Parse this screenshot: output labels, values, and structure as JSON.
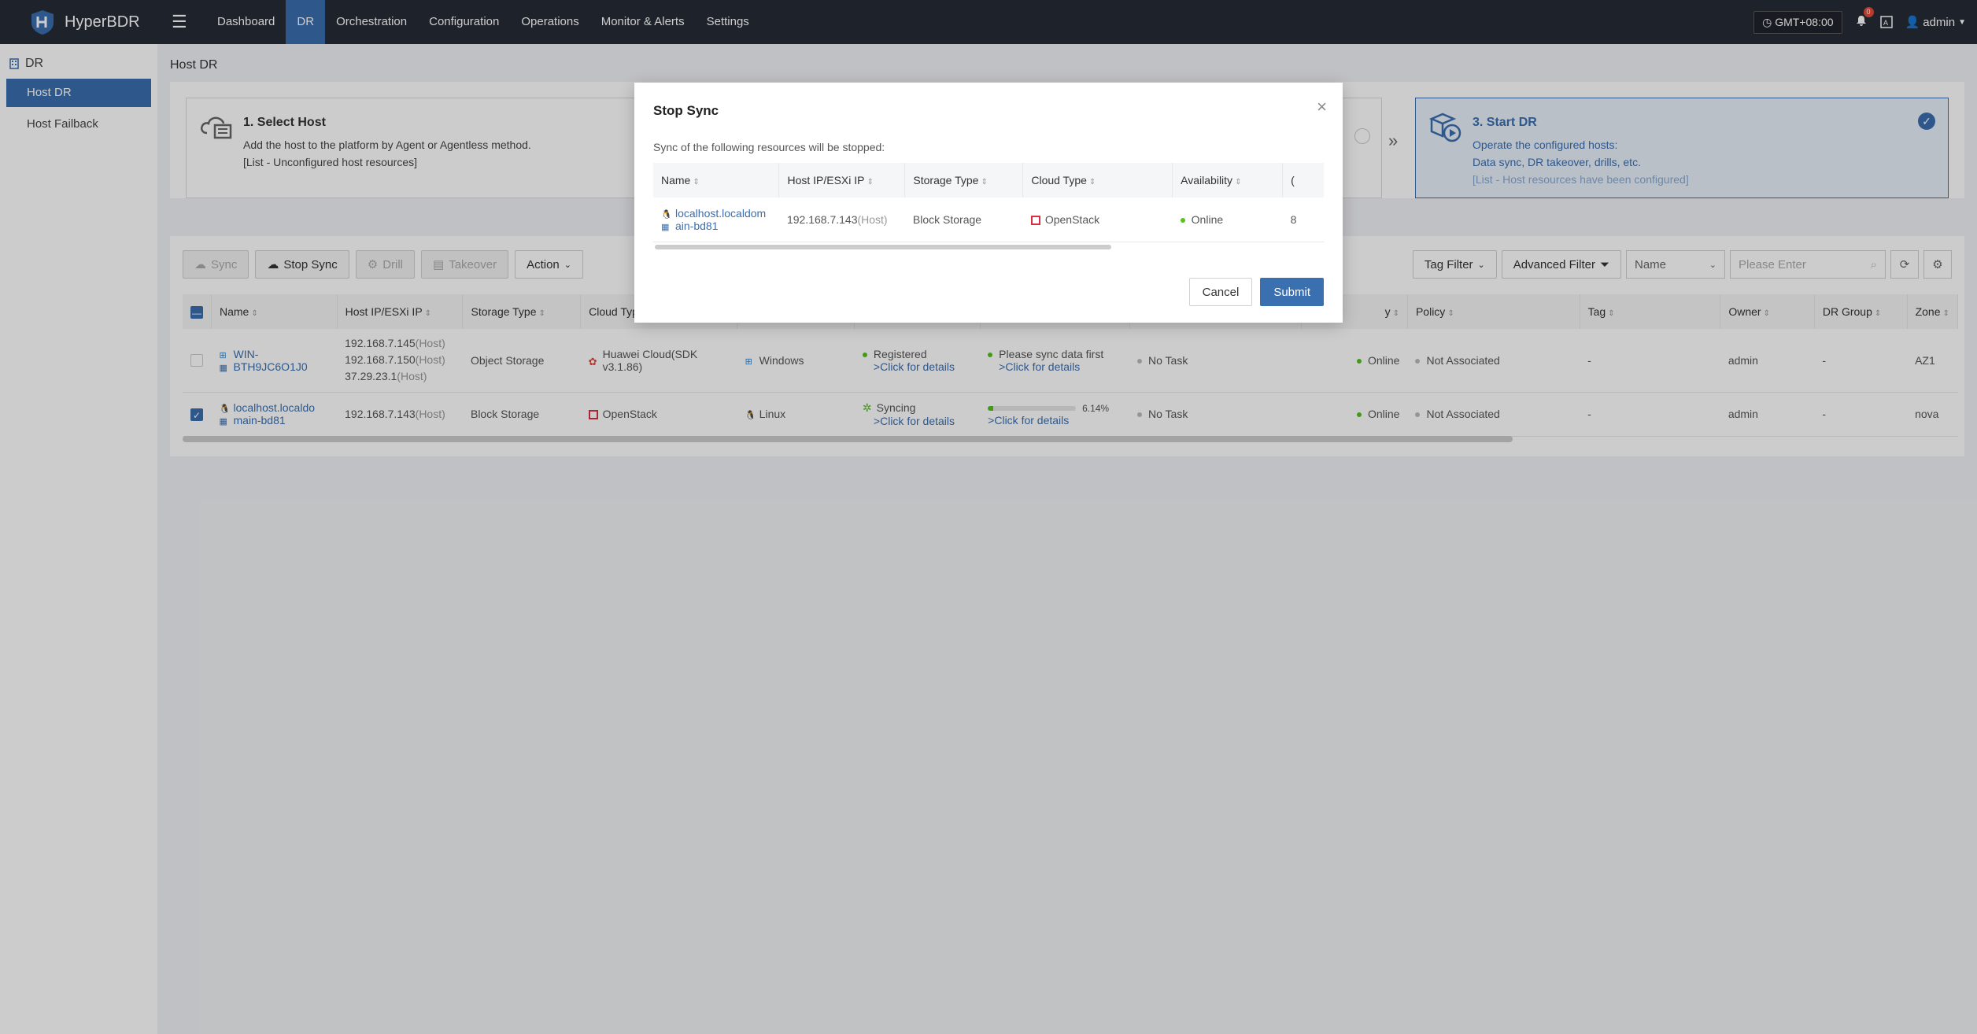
{
  "app": {
    "name": "HyperBDR"
  },
  "nav": {
    "items": [
      {
        "label": "Dashboard"
      },
      {
        "label": "DR"
      },
      {
        "label": "Orchestration"
      },
      {
        "label": "Configuration"
      },
      {
        "label": "Operations"
      },
      {
        "label": "Monitor & Alerts"
      },
      {
        "label": "Settings"
      }
    ],
    "timezone": "GMT+08:00",
    "alert_count": "0",
    "user": "admin"
  },
  "sidebar": {
    "section": "DR",
    "items": [
      {
        "label": "Host DR"
      },
      {
        "label": "Host Failback"
      }
    ]
  },
  "page": {
    "title": "Host DR"
  },
  "steps": {
    "step1": {
      "title": "1. Select Host",
      "line1": "Add the host to the platform by Agent or Agentless method.",
      "line2": "[List - Unconfigured host resources]"
    },
    "step3": {
      "title": "3. Start DR",
      "line1": "Operate the configured hosts:",
      "line2": "Data sync, DR takeover, drills, etc.",
      "line3": "[List - Host resources have been configured]"
    }
  },
  "toolbar": {
    "sync": "Sync",
    "stop_sync": "Stop Sync",
    "drill": "Drill",
    "takeover": "Takeover",
    "action": "Action",
    "tag_filter": "Tag Filter",
    "advanced_filter": "Advanced Filter",
    "search_field": "Name",
    "search_placeholder": "Please Enter"
  },
  "table": {
    "headers": {
      "name": "Name",
      "ip": "Host IP/ESXi IP",
      "storage": "Storage Type",
      "cloud": "Cloud Typ",
      "availability_frag": "y",
      "policy": "Policy",
      "tag": "Tag",
      "owner": "Owner",
      "group": "DR Group",
      "zone": "Zone"
    },
    "rows": [
      {
        "name1": "WIN-",
        "name2": "BTH9JC6O1J0",
        "ips": [
          {
            "ip": "192.168.7.145",
            "tag": "(Host)"
          },
          {
            "ip": "192.168.7.150",
            "tag": "(Host)"
          },
          {
            "ip": "37.29.23.1",
            "tag": "(Host)"
          }
        ],
        "storage": "Object Storage",
        "cloud1": "Huawei Cloud(SDK",
        "cloud2": "v3.1.86)",
        "os": "Windows",
        "agent_status": "Registered",
        "agent_link": ">Click for details",
        "sync_status": "Please sync data first",
        "sync_link": ">Click for details",
        "task": "No Task",
        "availability": "Online",
        "policy": "Not Associated",
        "tag": "-",
        "owner": "admin",
        "group": "-",
        "zone": "AZ1"
      },
      {
        "name1": "localhost.localdo",
        "name2": "main-bd81",
        "ips": [
          {
            "ip": "192.168.7.143",
            "tag": "(Host)"
          }
        ],
        "storage": "Block Storage",
        "cloud1": "OpenStack",
        "os": "Linux",
        "agent_status": "Syncing",
        "agent_link": ">Click for details",
        "sync_percent": "6.14%",
        "sync_link": ">Click for details",
        "task": "No Task",
        "availability": "Online",
        "policy": "Not Associated",
        "tag": "-",
        "owner": "admin",
        "group": "-",
        "zone": "nova"
      }
    ]
  },
  "modal": {
    "title": "Stop Sync",
    "message": "Sync of the following resources will be stopped:",
    "headers": {
      "name": "Name",
      "ip": "Host IP/ESXi IP",
      "storage": "Storage Type",
      "cloud": "Cloud Type",
      "availability": "Availability",
      "next": "("
    },
    "row": {
      "name1": "localhost.localdom",
      "name2": "ain-bd81",
      "ip": "192.168.7.143",
      "ip_tag": "(Host)",
      "storage": "Block Storage",
      "cloud": "OpenStack",
      "availability": "Online",
      "next": "8"
    },
    "cancel": "Cancel",
    "submit": "Submit"
  },
  "colors": {
    "nav_bg": "#262c36",
    "accent": "#3a6fb0",
    "online": "#52c41a",
    "openstack": "#d9303f",
    "huawei": "#e8413b"
  }
}
